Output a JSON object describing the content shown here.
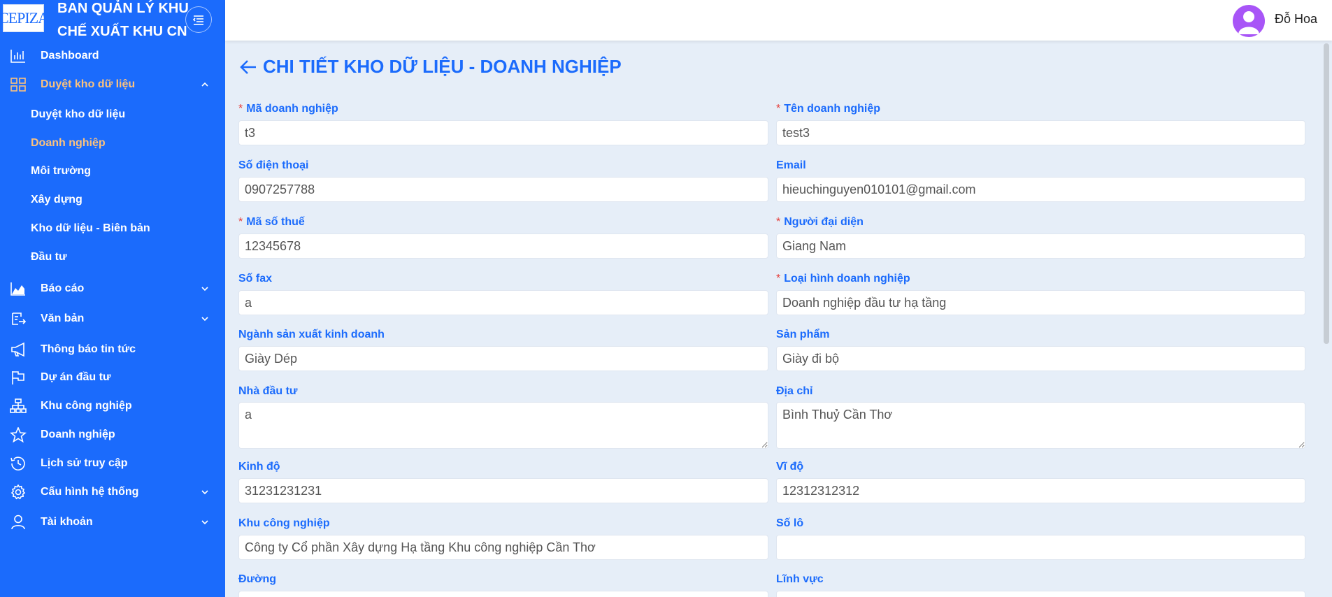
{
  "sidebar": {
    "logo_text": "CEPIZA",
    "brand_line1": "BAN QUẢN LÝ KHU",
    "brand_line2": "CHẾ XUẤT KHU CN",
    "items": [
      {
        "label": "Dashboard",
        "icon": "bar-chart-icon"
      },
      {
        "label": "Duyệt kho dữ liệu",
        "icon": "grid-icon"
      },
      {
        "label": "Báo cáo",
        "icon": "area-chart-icon"
      },
      {
        "label": "Văn bản",
        "icon": "document-transfer-icon"
      },
      {
        "label": "Thông báo tin tức",
        "icon": "megaphone-icon"
      },
      {
        "label": "Dự án đầu tư",
        "icon": "flag-icon"
      },
      {
        "label": "Khu công nghiệp",
        "icon": "hierarchy-icon"
      },
      {
        "label": "Doanh nghiệp",
        "icon": "star-icon"
      },
      {
        "label": "Lịch sử truy cập",
        "icon": "clock-icon"
      },
      {
        "label": "Cấu hình hệ thống",
        "icon": "gear-icon"
      },
      {
        "label": "Tài khoản",
        "icon": "user-icon"
      }
    ],
    "sub_items": [
      {
        "label": "Duyệt kho dữ liệu"
      },
      {
        "label": "Doanh nghiệp"
      },
      {
        "label": "Môi trường"
      },
      {
        "label": "Xây dựng"
      },
      {
        "label": "Kho dữ liệu - Biên bản"
      },
      {
        "label": "Đầu tư"
      }
    ],
    "colors": {
      "background": "#1b6bfc",
      "active": "#fbc27e"
    }
  },
  "header": {
    "user_name": "Đỗ Hoa"
  },
  "main": {
    "title": "CHI TIẾT KHO DỮ LIỆU - DOANH NGHIỆP",
    "fields": {
      "ma_dn": {
        "label": "Mã doanh nghiệp",
        "value": "t3",
        "required": true
      },
      "ten_dn": {
        "label": "Tên doanh nghiệp",
        "value": "test3",
        "required": true
      },
      "sdt": {
        "label": "Số điện thoại",
        "value": "0907257788"
      },
      "email": {
        "label": "Email",
        "value": "hieuchinguyen010101@gmail.com"
      },
      "mst": {
        "label": "Mã số thuế",
        "value": "12345678",
        "required": true
      },
      "nguoi_dd": {
        "label": "Người đại diện",
        "value": "Giang Nam",
        "required": true
      },
      "fax": {
        "label": "Số fax",
        "value": "a"
      },
      "loai_hinh": {
        "label": "Loại hình doanh nghiệp",
        "value": "Doanh nghiệp đầu tư hạ tầng",
        "required": true
      },
      "nganh": {
        "label": "Ngành sản xuất kinh doanh",
        "value": "Giày Dép"
      },
      "san_pham": {
        "label": "Sản phẩm",
        "value": "Giày đi bộ"
      },
      "nha_dau_tu": {
        "label": "Nhà đầu tư",
        "value": "a"
      },
      "dia_chi": {
        "label": "Địa chỉ",
        "value": "Bình Thuỷ Cần Thơ"
      },
      "kinh_do": {
        "label": "Kinh độ",
        "value": "31231231231"
      },
      "vi_do": {
        "label": "Vĩ độ",
        "value": "12312312312"
      },
      "khu_cn": {
        "label": "Khu công nghiệp",
        "value": "Công ty Cổ phần Xây dựng Hạ tầng Khu công nghiệp Cần Thơ"
      },
      "so_lo": {
        "label": "Số lô",
        "value": ""
      },
      "duong": {
        "label": "Đường",
        "value": ""
      },
      "linh_vuc": {
        "label": "Lĩnh vực",
        "value": ""
      }
    },
    "required_mark": "*",
    "accent": "#1b6bfc",
    "required_color": "#e53935"
  }
}
